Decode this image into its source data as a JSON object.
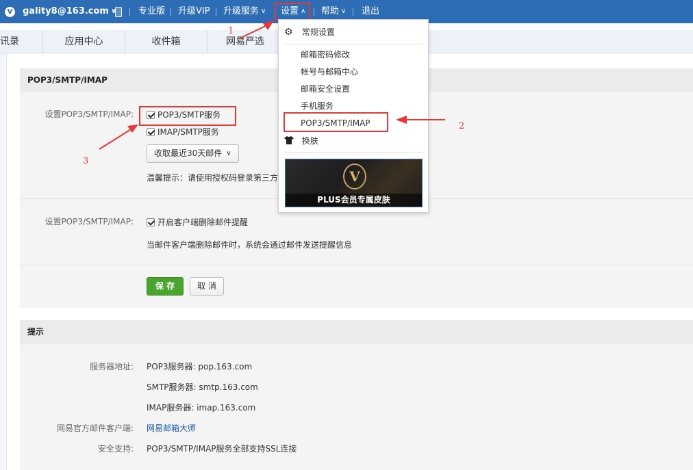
{
  "topbar": {
    "account": "gality8@163.com",
    "pro": "专业版",
    "upgrade_vip": "升级VIP",
    "upgrade_service": "升级服务",
    "settings": "设置",
    "help": "帮助",
    "logout": "退出"
  },
  "tabs": [
    "讯录",
    "应用中心",
    "收件箱",
    "网易严选"
  ],
  "settings_menu": {
    "general": "常规设置",
    "password": "邮箱密码修改",
    "account_center": "帐号与邮箱中心",
    "security": "邮箱安全设置",
    "mobile": "手机服务",
    "pop": "POP3/SMTP/IMAP",
    "skin": "换肤",
    "plus_banner": "PLUS会员专属皮肤",
    "plus_letter": "V"
  },
  "pop_panel": {
    "title": "POP3/SMTP/IMAP",
    "label1": "设置POP3/SMTP/IMAP:",
    "pop_service": "POP3/SMTP服务",
    "pop_checked": true,
    "imap_service": "IMAP/SMTP服务",
    "imap_checked": true,
    "receive_select": "收取最近30天邮件",
    "tip": "温馨提示：请使用授权码登录第三方",
    "label2": "设置POP3/SMTP/IMAP:",
    "delete_notice": "开启客户端删除邮件提醒",
    "delete_checked": true,
    "delete_desc": "当邮件客户端删除邮件时，系统会通过邮件发送提醒信息",
    "save": "保 存",
    "cancel": "取 消"
  },
  "hint_panel": {
    "title": "提示",
    "server_label": "服务器地址:",
    "pop_server": "POP3服务器: pop.163.com",
    "smtp_server": "SMTP服务器: smtp.163.com",
    "imap_server": "IMAP服务器: imap.163.com",
    "client_label": "网易官方邮件客户端:",
    "client_link": "网易邮箱大师",
    "ssl_label": "安全支持:",
    "ssl_value": "POP3/SMTP/IMAP服务全部支持SSL连接"
  },
  "annotations": [
    "1",
    "2",
    "3"
  ],
  "colors": {
    "topbar": "#2d6db5",
    "annotation": "#e53935",
    "save": "#4aa52e"
  }
}
